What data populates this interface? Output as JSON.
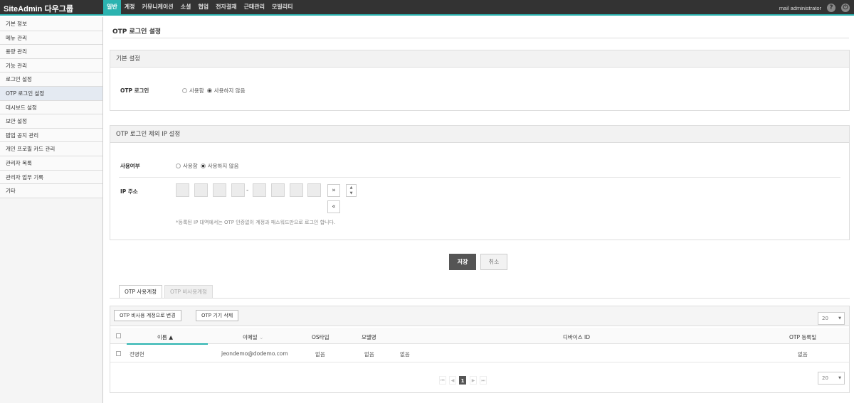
{
  "app": {
    "brand": "SiteAdmin",
    "brand_sub": "다우그룹"
  },
  "topnav": [
    "일반",
    "계정",
    "커뮤니케이션",
    "소셜",
    "협업",
    "전자결재",
    "근태관리",
    "모빌리티"
  ],
  "topnav_active": 0,
  "user": {
    "name": "mail administrator",
    "help_icon": "question-icon",
    "power_icon": "power-icon"
  },
  "sidebar": {
    "items": [
      "기본 정보",
      "메뉴 관리",
      "용량 관리",
      "기능 관리",
      "로그인 설정",
      "OTP 로그인 설정",
      "대시보드 설정",
      "보안 설정",
      "팝업 공지 관리",
      "개인 프로필 카드 관리",
      "관리자 목록",
      "관리자 업무 기록",
      "기타"
    ],
    "active": 5
  },
  "page": {
    "title": "OTP 로그인 설정"
  },
  "basic": {
    "heading": "기본 설정",
    "otp_label": "OTP 로그인",
    "opt_use": "사용함",
    "opt_nouse": "사용하지 않음",
    "selected": "사용하지 않음"
  },
  "ipexclude": {
    "heading": "OTP 로그인 제외 IP 설정",
    "use_label": "사용여부",
    "opt_use": "사용함",
    "opt_nouse": "사용하지 않음",
    "selected": "사용하지 않음",
    "ip_label": "IP 주소",
    "dash": "-",
    "add_glyph": "»",
    "remove_glyph": "«",
    "note": "*등록된 IP 대역에서는 OTP 인증없이 계정과 패스워드만으로 로그인 합니다."
  },
  "actions": {
    "save": "저장",
    "cancel": "취소"
  },
  "tabs": [
    {
      "label": "OTP 사용계정",
      "active": true
    },
    {
      "label": "OTP 비사용계정",
      "active": false
    }
  ],
  "grid": {
    "toolbar": {
      "to_nonuse": "OTP 비사용 계정으로 변경",
      "delete_device": "OTP 기기 삭제"
    },
    "page_size": "20",
    "columns": {
      "name": "이름",
      "email": "이메일",
      "os": "OS타입",
      "model": "모델명",
      "device": "디바이스 ID",
      "reg": "OTP 등록일"
    },
    "rows": [
      {
        "name": "전병헌",
        "email": "jeondemo@dodemo.com",
        "os": "없음",
        "model": "없음",
        "device": "없음",
        "reg": "없음"
      }
    ],
    "pagination": {
      "current": "1"
    }
  }
}
